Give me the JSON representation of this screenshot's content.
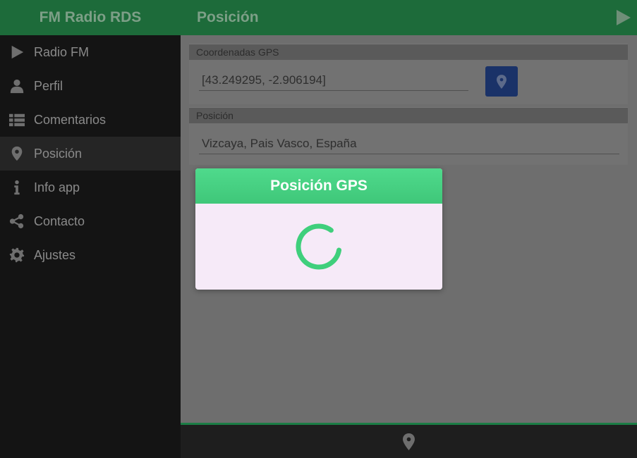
{
  "sidebar": {
    "title": "FM Radio RDS",
    "items": [
      {
        "label": "Radio FM",
        "icon": "play-icon"
      },
      {
        "label": "Perfil",
        "icon": "user-icon"
      },
      {
        "label": "Comentarios",
        "icon": "list-icon"
      },
      {
        "label": "Posición",
        "icon": "map-marker-icon",
        "active": true
      },
      {
        "label": "Info app",
        "icon": "info-icon"
      },
      {
        "label": "Contacto",
        "icon": "share-icon"
      },
      {
        "label": "Ajustes",
        "icon": "gear-icon"
      }
    ]
  },
  "header": {
    "title": "Posición",
    "play_icon": "play-icon"
  },
  "coords": {
    "header": "Coordenadas GPS",
    "value": "[43.249295, -2.906194]",
    "button_icon": "map-marker-icon"
  },
  "position": {
    "header": "Posición",
    "value": "Vizcaya, Pais Vasco, España"
  },
  "dialog": {
    "title": "Posición GPS",
    "spinner": "loading-spinner"
  },
  "footer": {
    "icon": "map-marker-icon"
  },
  "colors": {
    "brand_green": "#1d6b3a",
    "dialog_green": "#4fda8c",
    "gps_button": "#1a3268",
    "dialog_body": "#f6eaf8"
  }
}
